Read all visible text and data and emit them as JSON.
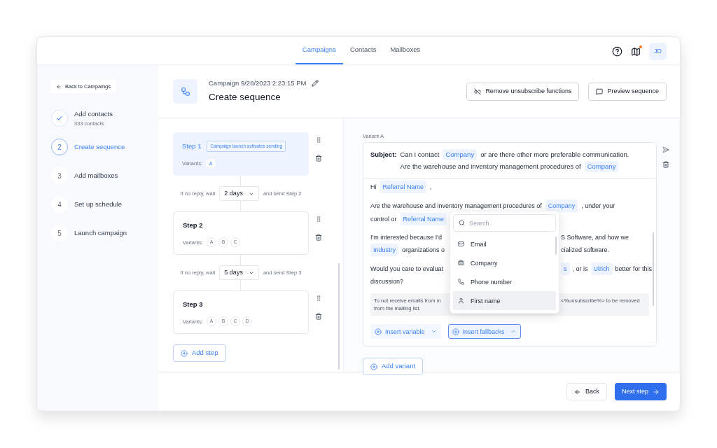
{
  "nav": {
    "tabs": [
      {
        "label": "Campaigns",
        "selected": true
      },
      {
        "label": "Contacts",
        "selected": false
      },
      {
        "label": "Mailboxes",
        "selected": false
      }
    ],
    "notification": true,
    "avatar": "JD"
  },
  "sidebar": {
    "back": "Back to Campaings",
    "steps": [
      {
        "kind": "done",
        "label": "Add contacts",
        "sub": "333 contacts"
      },
      {
        "kind": "current",
        "number": "2",
        "label": "Create sequence"
      },
      {
        "kind": "pending",
        "number": "3",
        "label": "Add mailboxes"
      },
      {
        "kind": "pending",
        "number": "4",
        "label": "Set up schedule"
      },
      {
        "kind": "pending",
        "number": "5",
        "label": "Launch campaign"
      }
    ]
  },
  "header": {
    "subtitle": "Campaign 9/28/2023 2:23:15 PM",
    "title": "Create sequence",
    "buttons": [
      "Remove unsubscribe functions",
      "Preview sequence"
    ]
  },
  "sequence": {
    "steps": [
      {
        "title": "Step 1",
        "selected": true,
        "badge": "Campaign launch activates sending",
        "variants_label": "Variants:",
        "variants": [
          "A"
        ]
      },
      {
        "title": "Step 2",
        "selected": false,
        "variants_label": "Variants:",
        "variants": [
          "A",
          "B",
          "C"
        ]
      },
      {
        "title": "Step 3",
        "selected": false,
        "variants_label": "Variants:",
        "variants": [
          "A",
          "B",
          "C",
          "D"
        ]
      }
    ],
    "waits": [
      {
        "prefix": "If no reply, wait",
        "value": "2 days",
        "suffix": "and send Step 2"
      },
      {
        "prefix": "If no reply, wait",
        "value": "5 days",
        "suffix": "and send Step 3"
      }
    ],
    "add_step": "Add step"
  },
  "editor": {
    "variant_label": "Variant A",
    "subject_label": "Subject:",
    "subject_lines": [
      [
        {
          "kind": "text",
          "text": "Can I contact"
        },
        {
          "kind": "variable",
          "text": "Company"
        },
        {
          "kind": "text",
          "text": "or are there other more preferable communication."
        }
      ],
      [
        {
          "kind": "text",
          "text": "Are the warehouse and inventory management procedures of"
        },
        {
          "kind": "variable",
          "text": "Company"
        }
      ]
    ],
    "paragraphs": [
      {
        "lines": [
          {
            "segments": [
              {
                "kind": "text",
                "text": "Hi"
              },
              {
                "kind": "variable",
                "text": "Referral Name"
              },
              {
                "kind": "text",
                "text": ","
              }
            ]
          }
        ]
      },
      {
        "lines": [
          {
            "segments": [
              {
                "kind": "text",
                "text": "Are the warehouse and inventory management procedures of"
              },
              {
                "kind": "variable",
                "text": "Company"
              },
              {
                "kind": "text",
                "text": ", under your"
              }
            ]
          },
          {
            "left": [
              {
                "kind": "text",
                "text": "control or"
              },
              {
                "kind": "variable",
                "text": "Referral Name"
              }
            ]
          }
        ]
      },
      {
        "lines": [
          {
            "left": [
              {
                "kind": "text",
                "text": "I'm interested because I'd"
              }
            ],
            "right": [
              {
                "kind": "text",
                "text": "S Software, and how we"
              }
            ]
          },
          {
            "left": [
              {
                "kind": "variable",
                "text": "Industry"
              },
              {
                "kind": "text",
                "text": "organizations o"
              }
            ],
            "right": [
              {
                "kind": "text",
                "text": "cialized software."
              }
            ]
          }
        ]
      },
      {
        "lines": [
          {
            "left": [
              {
                "kind": "text",
                "text": "Would you care to evaluat"
              }
            ],
            "right": [
              {
                "kind": "variable",
                "text": "s"
              },
              {
                "kind": "text",
                "text": ", or is"
              },
              {
                "kind": "variable",
                "text": "Ulrich"
              },
              {
                "kind": "text",
                "text": "better for this"
              }
            ]
          },
          {
            "segments": [
              {
                "kind": "text",
                "text": "discussion?"
              }
            ]
          }
        ]
      }
    ],
    "note": {
      "left": "To not receive emails from m",
      "right": "<%unsubscribe%> to be removed",
      "last": "from the mailing list."
    },
    "insert_buttons": [
      {
        "label": "Insert variable",
        "expanded": false
      },
      {
        "label": "Insert fallbacks",
        "expanded": true
      }
    ],
    "add_variant": "Add variant"
  },
  "dropdown": {
    "placeholder": "Search",
    "items": [
      {
        "label": "Email",
        "selected": false
      },
      {
        "label": "Company",
        "selected": false
      },
      {
        "label": "Phone number",
        "selected": false
      },
      {
        "label": "First name",
        "selected": true
      }
    ]
  },
  "footer": {
    "back": "Back",
    "next": "Next step"
  }
}
